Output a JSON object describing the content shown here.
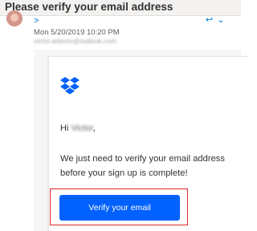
{
  "subject": "Please verify your email address",
  "sender": {
    "expand_glyph": ">",
    "actions_glyph": "↩ ⌄",
    "date": "Mon 5/20/2019 10:20 PM",
    "recipient": "victor.arborio@outlook.com"
  },
  "email": {
    "greeting_prefix": "Hi ",
    "greeting_name": "Victor",
    "greeting_suffix": ",",
    "body_line_1": "We just need to verify your email address",
    "body_line_2": "before your sign up is complete!",
    "button_label": "Verify your email"
  },
  "colors": {
    "accent": "#0061fe",
    "highlight": "#e0242b",
    "link": "#0078d4"
  }
}
